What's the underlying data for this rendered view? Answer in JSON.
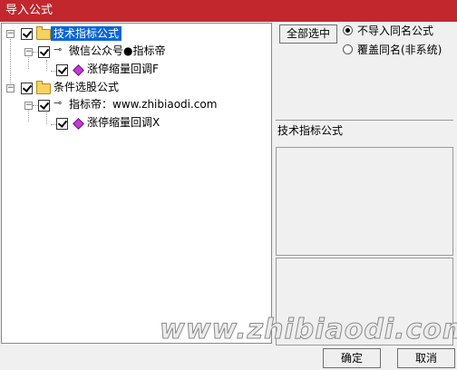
{
  "window": {
    "title": "导入公式"
  },
  "tree": {
    "root1": {
      "label": "技术指标公式"
    },
    "group1": {
      "label": "微信公众号●指标帝"
    },
    "item1": {
      "label": "涨停缩量回调F"
    },
    "root2": {
      "label": "条件选股公式"
    },
    "group2": {
      "label": "指标帝：www.zhibiaodi.com"
    },
    "item2": {
      "label": "涨停缩量回调X"
    }
  },
  "options": {
    "select_all_label": "全部选中",
    "radio_skip": "不导入同名公式",
    "radio_overwrite": "覆盖同名(非系统)",
    "selected": "radio_skip"
  },
  "info": {
    "category": "技术指标公式"
  },
  "watermark": "www.zhibiaodi.com",
  "footer": {
    "ok": "确定",
    "cancel": "取消"
  }
}
